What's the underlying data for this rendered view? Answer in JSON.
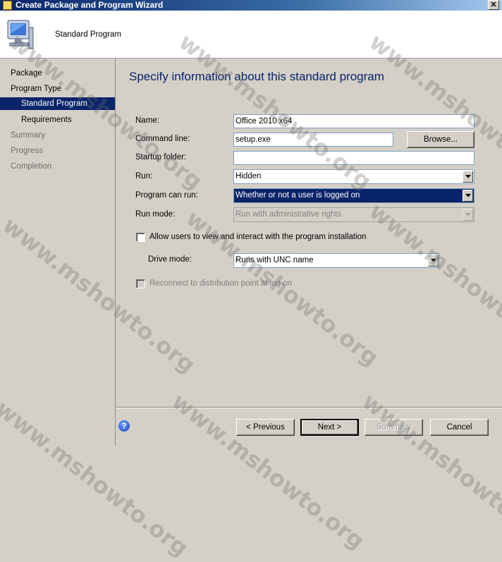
{
  "window": {
    "title": "Create Package and Program Wizard",
    "close_glyph": "✕"
  },
  "header": {
    "title": "Standard Program",
    "icon": "computer-icon"
  },
  "nav": [
    {
      "label": "Package",
      "state": "done"
    },
    {
      "label": "Program Type",
      "state": "done"
    },
    {
      "label": "Standard Program",
      "state": "active"
    },
    {
      "label": "Requirements",
      "state": "sub"
    },
    {
      "label": "Summary",
      "state": "future"
    },
    {
      "label": "Progress",
      "state": "future"
    },
    {
      "label": "Completion",
      "state": "future"
    }
  ],
  "page": {
    "title": "Specify information about this standard program"
  },
  "form": {
    "name_label": "Name:",
    "name_value": "Office 2010 x64",
    "command_line_label": "Command line:",
    "command_line_value": "setup.exe",
    "browse_label": "Browse...",
    "startup_folder_label": "Startup folder:",
    "startup_folder_value": "",
    "run_label": "Run:",
    "run_value": "Hidden",
    "program_can_run_label": "Program can run:",
    "program_can_run_value": "Whether or not a user is logged on",
    "run_mode_label": "Run mode:",
    "run_mode_value": "Run with administrative rights",
    "allow_interact_label": "Allow users to view and interact with the program installation",
    "allow_interact_checked": false,
    "drive_mode_label": "Drive mode:",
    "drive_mode_value": "Runs with UNC name",
    "reconnect_label": "Reconnect to distribution point at log on",
    "reconnect_checked": false
  },
  "footer": {
    "help_glyph": "?",
    "previous_label": "< Previous",
    "next_label": "Next >",
    "summary_label": "Summary",
    "cancel_label": "Cancel"
  },
  "watermark": {
    "text": "www.mshowto.org"
  },
  "colors": {
    "accent": "#0a246a",
    "title_text": "#0a246a",
    "disabled_text": "#808080"
  }
}
